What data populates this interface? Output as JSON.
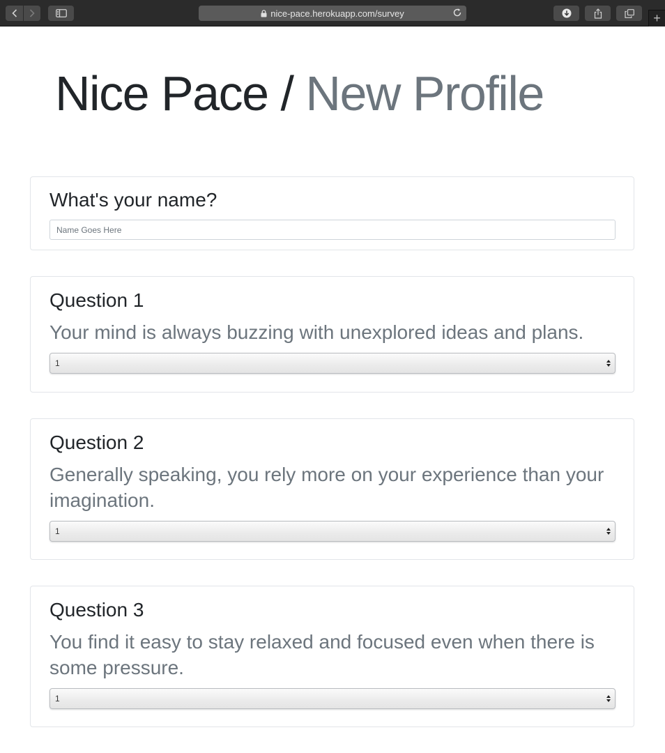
{
  "browser": {
    "url": "nice-pace.herokuapp.com/survey",
    "icons": [
      "back-icon",
      "forward-icon",
      "sidebar-icon",
      "lock-icon",
      "reload-icon",
      "download-icon",
      "share-icon",
      "tabs-icon",
      "plus-icon"
    ],
    "new_tab_glyph": "+"
  },
  "header": {
    "brand": "Nice Pace",
    "separator": "/",
    "subtitle": "New Profile"
  },
  "name_section": {
    "label": "What's your name?",
    "placeholder": "Name Goes Here",
    "value": ""
  },
  "questions": [
    {
      "label": "Question 1",
      "text": "Your mind is always buzzing with unexplored ideas and plans.",
      "selected": "1"
    },
    {
      "label": "Question 2",
      "text": "Generally speaking, you rely more on your experience than your imagination.",
      "selected": "1"
    },
    {
      "label": "Question 3",
      "text": "You find it easy to stay relaxed and focused even when there is some pressure.",
      "selected": "1"
    }
  ],
  "colors": {
    "title": "#212529",
    "muted": "#6c757d",
    "card_border": "#e2e5e9",
    "chrome": "#2b2b2b"
  }
}
